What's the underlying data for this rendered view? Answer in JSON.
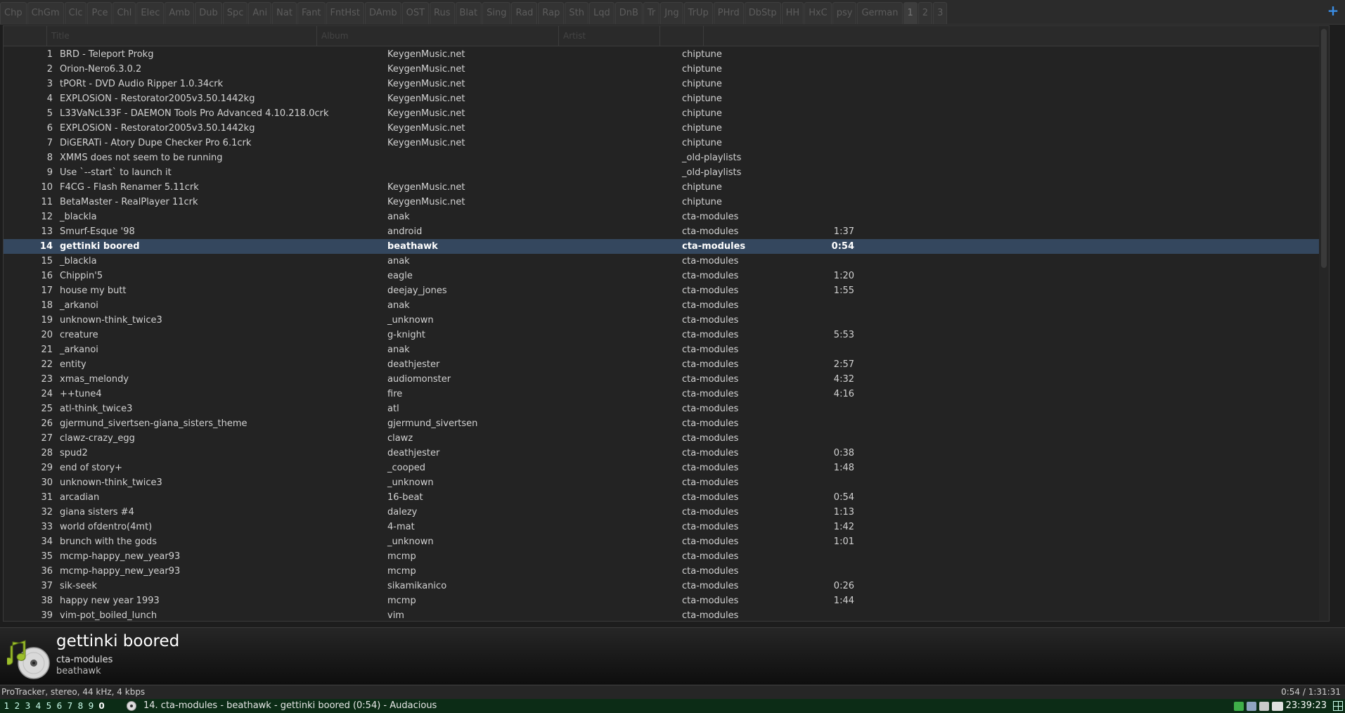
{
  "tabs": [
    "Chp",
    "ChGm",
    "Clc",
    "Pce",
    "Chl",
    "Elec",
    "Amb",
    "Dub",
    "Spc",
    "Ani",
    "Nat",
    "Fant",
    "FntHst",
    "DAmb",
    "OST",
    "Rus",
    "Blat",
    "Sing",
    "Rad",
    "Rap",
    "Sth",
    "Lqd",
    "DnB",
    "Tr",
    "Jng",
    "TrUp",
    "PHrd",
    "DbStp",
    "HH",
    "HxC",
    "psy",
    "German",
    "1",
    "2",
    "3"
  ],
  "active_tab_index": 32,
  "new_tab_icon": "plus-icon",
  "header": {
    "title": "Title",
    "album": "Album",
    "artist": "Artist"
  },
  "rows": [
    [
      "1",
      "BRD - Teleport Prokg",
      "KeygenMusic.net",
      "chiptune",
      ""
    ],
    [
      "2",
      "Orion-Nero6.3.0.2",
      "KeygenMusic.net",
      "chiptune",
      ""
    ],
    [
      "3",
      "tPORt - DVD Audio Ripper 1.0.34crk",
      "KeygenMusic.net",
      "chiptune",
      ""
    ],
    [
      "4",
      "EXPLOSiON - Restorator2005v3.50.1442kg",
      "KeygenMusic.net",
      "chiptune",
      ""
    ],
    [
      "5",
      "L33VaNcL33F - DAEMON Tools Pro Advanced 4.10.218.0crk",
      "KeygenMusic.net",
      "chiptune",
      ""
    ],
    [
      "6",
      "EXPLOSiON - Restorator2005v3.50.1442kg",
      "KeygenMusic.net",
      "chiptune",
      ""
    ],
    [
      "7",
      "DiGERATi - Atory Dupe Checker Pro 6.1crk",
      "KeygenMusic.net",
      "chiptune",
      ""
    ],
    [
      "8",
      "XMMS does not seem to be running",
      "",
      "_old-playlists",
      ""
    ],
    [
      "9",
      "Use `--start` to launch it",
      "",
      "_old-playlists",
      ""
    ],
    [
      "10",
      "F4CG - Flash Renamer 5.11crk",
      "KeygenMusic.net",
      "chiptune",
      ""
    ],
    [
      "11",
      "BetaMaster - RealPlayer 11crk",
      "KeygenMusic.net",
      "chiptune",
      ""
    ],
    [
      "12",
      "_blackla",
      "anak",
      "cta-modules",
      ""
    ],
    [
      "13",
      "Smurf-Esque '98",
      "android",
      "cta-modules",
      "1:37"
    ],
    [
      "14",
      "gettinki boored",
      "beathawk",
      "cta-modules",
      "0:54"
    ],
    [
      "15",
      "_blackla",
      "anak",
      "cta-modules",
      ""
    ],
    [
      "16",
      "Chippin'5",
      "eagle",
      "cta-modules",
      "1:20"
    ],
    [
      "17",
      "house my butt",
      "deejay_jones",
      "cta-modules",
      "1:55"
    ],
    [
      "18",
      "_arkanoi",
      "anak",
      "cta-modules",
      ""
    ],
    [
      "19",
      "unknown-think_twice3",
      "_unknown",
      "cta-modules",
      ""
    ],
    [
      "20",
      "creature",
      "g-knight",
      "cta-modules",
      "5:53"
    ],
    [
      "21",
      "_arkanoi",
      "anak",
      "cta-modules",
      ""
    ],
    [
      "22",
      "entity",
      "deathjester",
      "cta-modules",
      "2:57"
    ],
    [
      "23",
      "xmas_melondy",
      "audiomonster",
      "cta-modules",
      "4:32"
    ],
    [
      "24",
      "++tune4",
      "fire",
      "cta-modules",
      "4:16"
    ],
    [
      "25",
      "atl-think_twice3",
      "atl",
      "cta-modules",
      ""
    ],
    [
      "26",
      "gjermund_sivertsen-giana_sisters_theme",
      "gjermund_sivertsen",
      "cta-modules",
      ""
    ],
    [
      "27",
      "clawz-crazy_egg",
      "clawz",
      "cta-modules",
      ""
    ],
    [
      "28",
      "spud2",
      "deathjester",
      "cta-modules",
      "0:38"
    ],
    [
      "29",
      "end of story+",
      "_cooped",
      "cta-modules",
      "1:48"
    ],
    [
      "30",
      "unknown-think_twice3",
      "_unknown",
      "cta-modules",
      ""
    ],
    [
      "31",
      "arcadian",
      "16-beat",
      "cta-modules",
      "0:54"
    ],
    [
      "32",
      "giana sisters #4",
      "dalezy",
      "cta-modules",
      "1:13"
    ],
    [
      "33",
      "world ofdentro(4mt)",
      "4-mat",
      "cta-modules",
      "1:42"
    ],
    [
      "34",
      "brunch with the gods",
      "_unknown",
      "cta-modules",
      "1:01"
    ],
    [
      "35",
      "mcmp-happy_new_year93",
      "mcmp",
      "cta-modules",
      ""
    ],
    [
      "36",
      "mcmp-happy_new_year93",
      "mcmp",
      "cta-modules",
      ""
    ],
    [
      "37",
      "sik-seek",
      "sikamikanico",
      "cta-modules",
      "0:26"
    ],
    [
      "38",
      "happy new year 1993",
      "mcmp",
      "cta-modules",
      "1:44"
    ],
    [
      "39",
      "vim-pot_boiled_lunch",
      "vim",
      "cta-modules",
      ""
    ]
  ],
  "selected_row_index": 13,
  "now_playing": {
    "title": "gettinki boored",
    "artist": "cta-modules",
    "album": "beathawk",
    "art_icon": "music-disc-icon"
  },
  "status": {
    "format": "ProTracker, stereo, 44 kHz, 4 kbps",
    "time": "0:54 / 1:31:31"
  },
  "taskbar": {
    "workspaces": [
      "1",
      "2",
      "3",
      "4",
      "5",
      "6",
      "7",
      "8",
      "9",
      "0"
    ],
    "current_workspace_index": 9,
    "task_title": "14. cta-modules - beathawk - gettinki boored (0:54) - Audacious",
    "clock": "23:39:23"
  },
  "colors": {
    "accent": "#3a8ee6",
    "selected_row": "#34475e",
    "taskbar": "#0c2c16"
  }
}
